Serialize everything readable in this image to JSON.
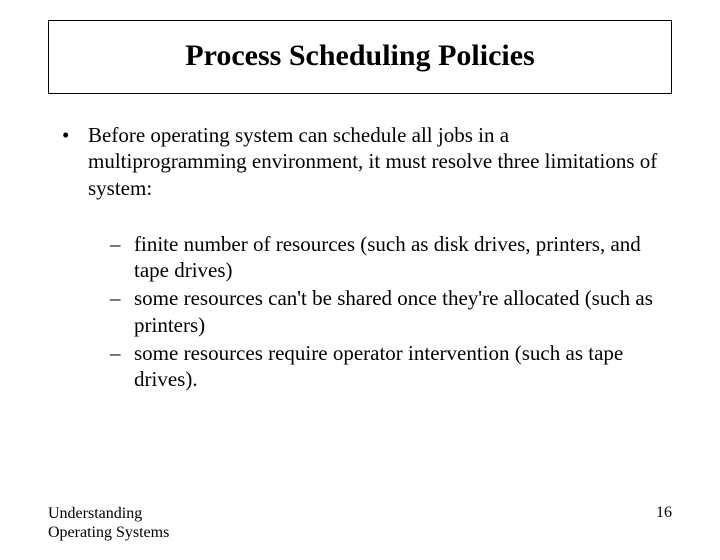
{
  "title": "Process Scheduling Policies",
  "bullet1": "Before operating system can schedule all jobs in a multiprogramming environment, it must resolve three limitations of system:",
  "sub1": "finite number of resources (such as disk drives, printers, and tape drives)",
  "sub2": "some resources can't be shared once they're allocated (such as printers)",
  "sub3": "some resources require operator intervention (such as tape drives).",
  "footer_left": "Understanding\nOperating Systems",
  "page_number": "16"
}
